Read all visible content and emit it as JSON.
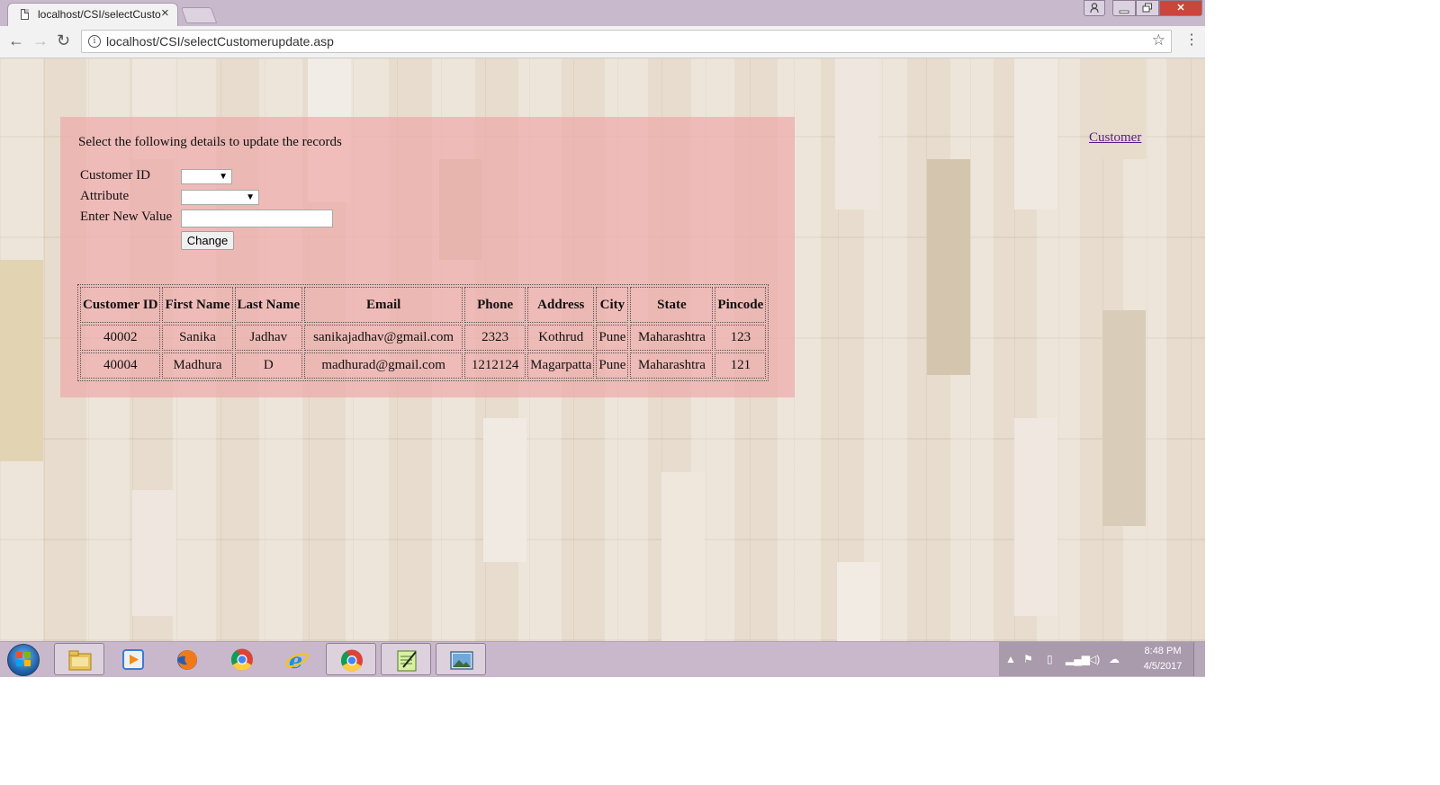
{
  "browser": {
    "tab_title": "localhost/CSI/selectCusto",
    "tab_close": "×",
    "url": "localhost/CSI/selectCustomerupdate.asp",
    "info_glyph": "i",
    "star_glyph": "☆",
    "back_glyph": "←",
    "forward_glyph": "→",
    "reload_glyph": "↻",
    "menu_glyph": "⋮",
    "window_buttons": {
      "minimize": "—",
      "maximize": "□",
      "close": "✕",
      "user": "👤"
    }
  },
  "page": {
    "instruction": "Select the following details to update the records",
    "form": {
      "customer_id_label": "Customer ID",
      "attribute_label": "Attribute",
      "new_value_label": "Enter New Value",
      "customer_id_selected": "",
      "attribute_selected": "",
      "new_value": "",
      "change_button": "Change"
    },
    "nav_link": "Customer",
    "table": {
      "headers": [
        "Customer ID",
        "First Name",
        "Last Name",
        "Email",
        "Phone",
        "Address",
        "City",
        "State",
        "Pincode"
      ],
      "rows": [
        [
          "40002",
          "Sanika",
          "Jadhav",
          "sanikajadhav@gmail.com",
          "2323",
          "Kothrud",
          "Pune",
          "Maharashtra",
          "123"
        ],
        [
          "40004",
          "Madhura",
          "D",
          "madhurad@gmail.com",
          "1212124",
          "Magarpatta",
          "Pune",
          "Maharashtra",
          "121"
        ]
      ]
    }
  },
  "taskbar": {
    "time": "8:48 PM",
    "date": "4/5/2017",
    "apps": [
      "file-explorer-icon",
      "media-player-icon",
      "firefox-icon",
      "chrome-icon",
      "internet-explorer-icon",
      "chrome-icon",
      "notepad-icon",
      "photo-viewer-icon"
    ],
    "tray_icons": [
      "show-hidden-icons",
      "action-center-flag-icon",
      "battery-icon",
      "network-signal-icon",
      "volume-icon",
      "cloud-icon"
    ]
  },
  "colors": {
    "panel": "#eeaaaa",
    "taskbar": "#c9b8cb",
    "link_visited": "#551a8b",
    "close_button": "#c9463d"
  }
}
